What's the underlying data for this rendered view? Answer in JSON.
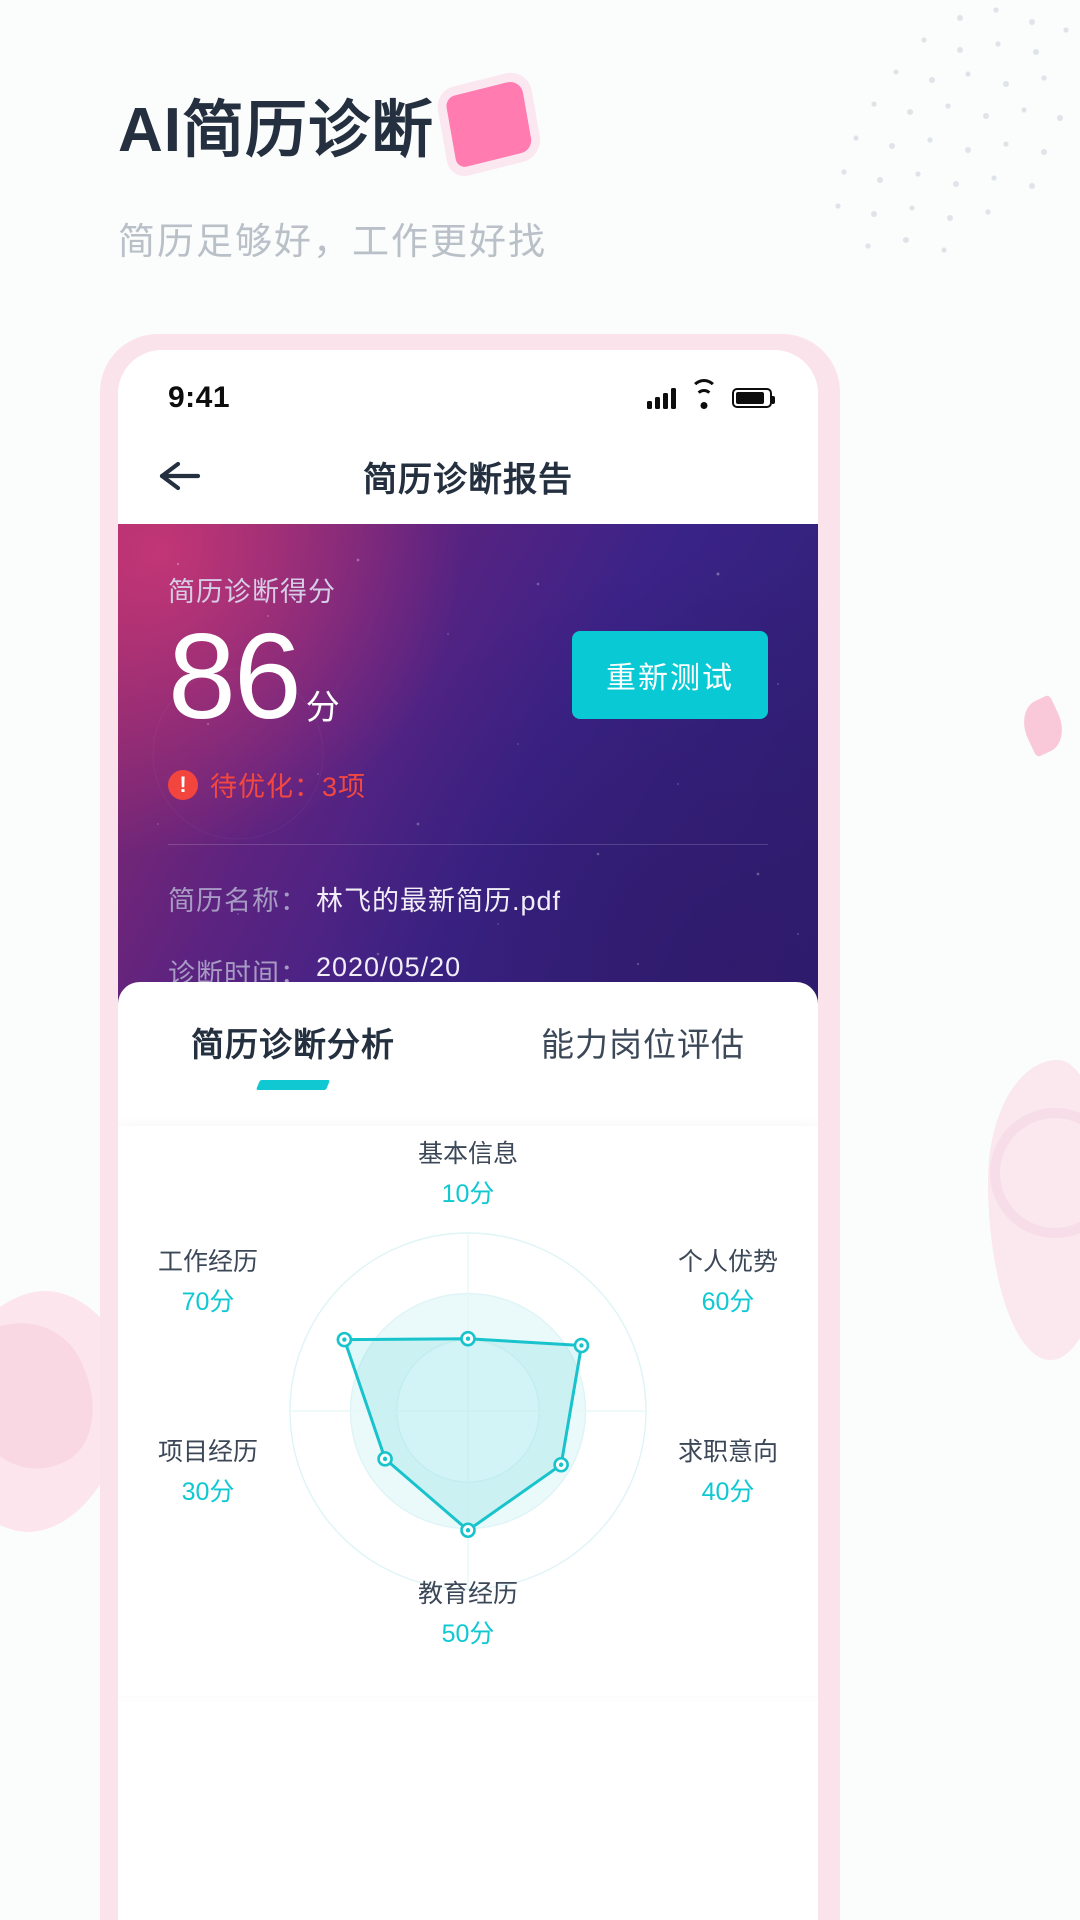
{
  "hero": {
    "title": "AI简历诊断",
    "subtitle": "简历足够好，工作更好找"
  },
  "phone": {
    "statusbar": {
      "time": "9:41",
      "signal_icon": "signal-bars-icon",
      "wifi_icon": "wifi-icon",
      "battery_icon": "battery-icon"
    },
    "navbar": {
      "back_icon": "back-arrow-icon",
      "title": "简历诊断报告"
    },
    "score_card": {
      "label": "简历诊断得分",
      "score": "86",
      "unit": "分",
      "retest_button": "重新测试",
      "warning_icon": "exclamation-circle-icon",
      "warning_text": "待优化：3项",
      "meta": [
        {
          "label": "简历名称：",
          "value": "林飞的最新简历.pdf"
        },
        {
          "label": "诊断时间：",
          "value": "2020/05/20"
        }
      ],
      "accent_color": "#08C9D4",
      "warning_color": "#F4473F"
    },
    "tabs": [
      {
        "label": "简历诊断分析",
        "active": true
      },
      {
        "label": "能力岗位评估",
        "active": false
      }
    ]
  },
  "chart_data": {
    "type": "radar",
    "title": "",
    "max": 100,
    "grid": true,
    "legend": "none",
    "line_color": "#18C3CC",
    "fill_color": "rgba(24,195,204,0.14)",
    "categories": [
      "基本信息",
      "个人优势",
      "求职意向",
      "教育经历",
      "项目经历",
      "工作经历"
    ],
    "values": [
      10,
      60,
      40,
      50,
      30,
      70
    ],
    "value_labels": [
      "10分",
      "60分",
      "40分",
      "50分",
      "30分",
      "70分"
    ],
    "series": [
      {
        "name": "简历诊断分析",
        "values": [
          10,
          60,
          40,
          50,
          30,
          70
        ]
      }
    ]
  }
}
